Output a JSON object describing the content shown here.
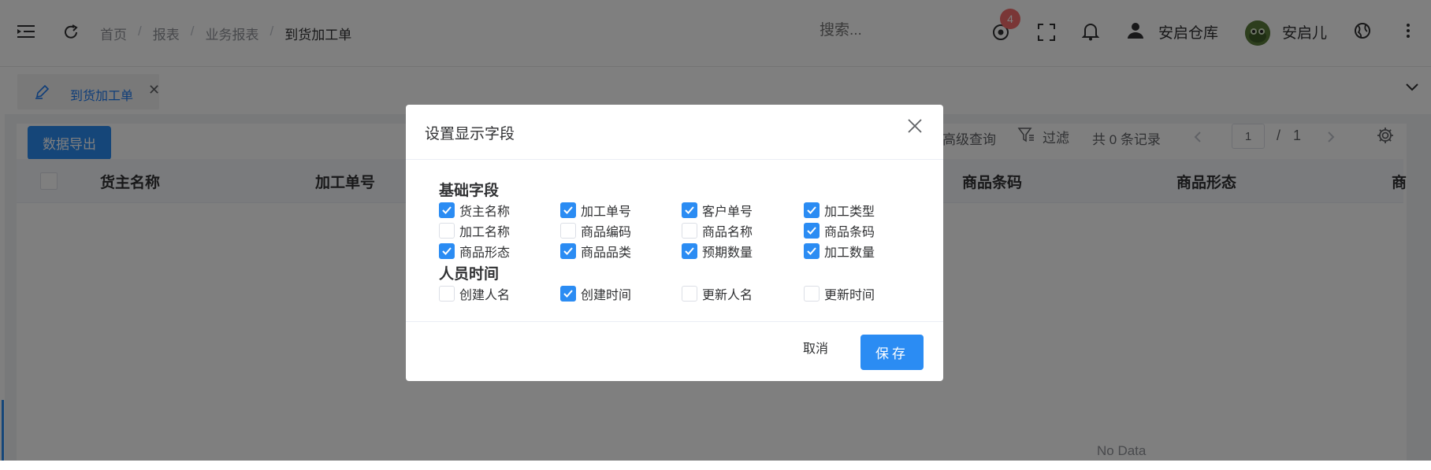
{
  "header": {
    "breadcrumb": [
      "首页",
      "报表",
      "业务报表",
      "到货加工单"
    ],
    "search_placeholder": "搜索...",
    "notification_count": "4",
    "warehouse_name": "安启仓库",
    "user_name": "安启儿"
  },
  "tab": {
    "label": "到货加工单"
  },
  "toolbar": {
    "export_label": "数据导出",
    "advanced_query_label": "高级查询",
    "filter_label": "过滤",
    "total_records": "共 0 条记录",
    "current_page": "1",
    "page_separator": "/",
    "total_pages": "1"
  },
  "table": {
    "headers": [
      "货主名称",
      "加工单号",
      "商品条码",
      "商品形态",
      "商"
    ],
    "empty_text": "No Data"
  },
  "dialog": {
    "title": "设置显示字段",
    "groups": [
      {
        "title": "基础字段",
        "fields": [
          {
            "label": "货主名称",
            "checked": true
          },
          {
            "label": "加工单号",
            "checked": true
          },
          {
            "label": "客户单号",
            "checked": true
          },
          {
            "label": "加工类型",
            "checked": true
          },
          {
            "label": "加工名称",
            "checked": false
          },
          {
            "label": "商品编码",
            "checked": false
          },
          {
            "label": "商品名称",
            "checked": false
          },
          {
            "label": "商品条码",
            "checked": true
          },
          {
            "label": "商品形态",
            "checked": true
          },
          {
            "label": "商品品类",
            "checked": true
          },
          {
            "label": "预期数量",
            "checked": true
          },
          {
            "label": "加工数量",
            "checked": true
          }
        ]
      },
      {
        "title": "人员时间",
        "fields": [
          {
            "label": "创建人名",
            "checked": false
          },
          {
            "label": "创建时间",
            "checked": true
          },
          {
            "label": "更新人名",
            "checked": false
          },
          {
            "label": "更新时间",
            "checked": false
          }
        ]
      }
    ],
    "cancel_label": "取消",
    "save_label": "保存"
  },
  "colors": {
    "primary": "#2b8cf3",
    "danger": "#f56c6c",
    "overlay": "rgba(0,0,0,0.5)"
  }
}
